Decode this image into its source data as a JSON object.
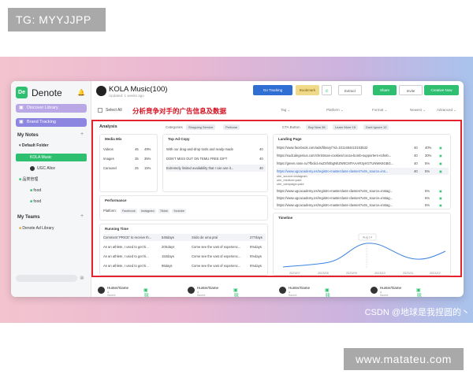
{
  "badge": "TG: MYYJJPP",
  "watermark_csdn": "CSDN @地球是我捏圆的丶",
  "watermark_site": "www.matateu.com",
  "sidebar": {
    "app_name": "Denote",
    "discover_label": "Discover Library",
    "brand_label": "Brand Tracking",
    "my_notes": "My Notes",
    "default_folder": "Default Folder",
    "kola": "KOLA Music",
    "ugc": "UGC Alice",
    "cn_folder": "品类管理",
    "food1": "food",
    "food2": "food",
    "my_teams": "My Teams",
    "team1": "Denote Ad Library"
  },
  "header": {
    "title": "KOLA Music(100)",
    "updated": "Updated: 1 weeks ago",
    "go_tracking": "Go Tracking",
    "bookmark": "Bookmark",
    "extract": "Extract",
    "share": "Share",
    "invite": "Invite",
    "create": "Creative Now"
  },
  "filters": {
    "select_all": "Select All",
    "annotation": "分析竞争对手的广告信息及数据",
    "tag": "Tag",
    "platform": "Platform",
    "format": "Format",
    "newest": "Newest",
    "advanced": "Advanced"
  },
  "analysis": {
    "title": "Analysis",
    "categories_label": "Categories",
    "cat1": "Shopping Service",
    "cat2": "Perfume",
    "cta_label": "CTA Button",
    "cta1": "Buy Now 36",
    "cta2": "Learn More 15",
    "cta3": "Dont Ignore 12"
  },
  "media_mix": {
    "title": "Media Mix",
    "rows": [
      {
        "name": "Videos",
        "count": "45",
        "pct": "49%"
      },
      {
        "name": "Images",
        "count": "35",
        "pct": "35%"
      },
      {
        "name": "Carousel",
        "count": "25",
        "pct": "15%"
      }
    ]
  },
  "top_ad_copy": {
    "title": "Top Ad Copy",
    "rows": [
      {
        "text": "With our drag-and-drop tools and ready-made",
        "n": "40"
      },
      {
        "text": "DON'T MISS OUT ON TEMU FREE GIFT",
        "n": "40"
      },
      {
        "text": "Extremely limited availability that I can use it...",
        "n": "40"
      }
    ]
  },
  "landing_page": {
    "title": "Landing Page",
    "rows": [
      {
        "url": "https://www.facebook.com/ads/library/?id=1011484410153532",
        "n": "40",
        "pct": "40%"
      },
      {
        "url": "https://eudcalegenius.com/christmas-cookies/cocoa-bomb-supporters-noheb...",
        "n": "40",
        "pct": "30%"
      },
      {
        "url": "https://green.nose.ru/?fbclid=IwZXh0bgNhZW0CMTAAAR3yrrGTUNWK6GBG...",
        "n": "40",
        "pct": "5%"
      },
      {
        "url": "https://www.ugcacademy.es/registro-masterclass-classes?utm_source=ins...",
        "n": "40",
        "pct": "5%"
      },
      {
        "url": "https://www.ugcacademy.es/registro-masterclass-classes?utm_source=instag...",
        "n": "",
        "pct": "5%"
      },
      {
        "url": "https://www.ugcacademy.es/registro-masterclass-classes?utm_source=instag...",
        "n": "",
        "pct": "5%"
      },
      {
        "url": "https://www.ugcacademy.es/registro-masterclass-classes?utm_source=instag...",
        "n": "",
        "pct": "5%"
      }
    ],
    "utm": [
      "utm_source=instagram",
      "utm_medium=paid",
      "utm_campaign=paid"
    ]
  },
  "performance": {
    "title": "Performance",
    "platform_label": "Platform:",
    "platforms": [
      "Facebook",
      "Instagram",
      "Tiktok",
      "Youtube"
    ]
  },
  "running_time": {
    "title": "Running Time",
    "rows": [
      {
        "a": "Comment 'PRICE' to receive th...",
        "ad": "545days",
        "b": "Sódo de uma praí",
        "bd": "277days"
      },
      {
        "a": "As an athlete, I used to get hi...",
        "ad": "20Sdays",
        "b": "Come see the vast of experienc...",
        "bd": "5%days"
      },
      {
        "a": "As an athlete, I used to get hi...",
        "ad": "153days",
        "b": "Come see the vast of experienc...",
        "bd": "5%days"
      },
      {
        "a": "As an athlete, I used to get hi...",
        "ad": "86days",
        "b": "Come see the vast of experienc...",
        "bd": "5%days"
      }
    ]
  },
  "timeline": {
    "title": "Timeline",
    "tooltip": "Aug 14",
    "ticks": [
      "2023/07",
      "2023/08",
      "2023/09",
      "2023/10",
      "2023/11",
      "2023/12"
    ]
  },
  "bottom_cards": [
    {
      "name": "Hunter/Game",
      "saved": "● Saved: 3 weeks ago"
    },
    {
      "name": "Hunter/Game",
      "saved": "● Saved: 3 weeks ago"
    },
    {
      "name": "Hunter/Game",
      "saved": "● Saved: 3 weeks ago"
    },
    {
      "name": "Hunter/Game",
      "saved": "● Saved: 3 weeks ago"
    }
  ]
}
